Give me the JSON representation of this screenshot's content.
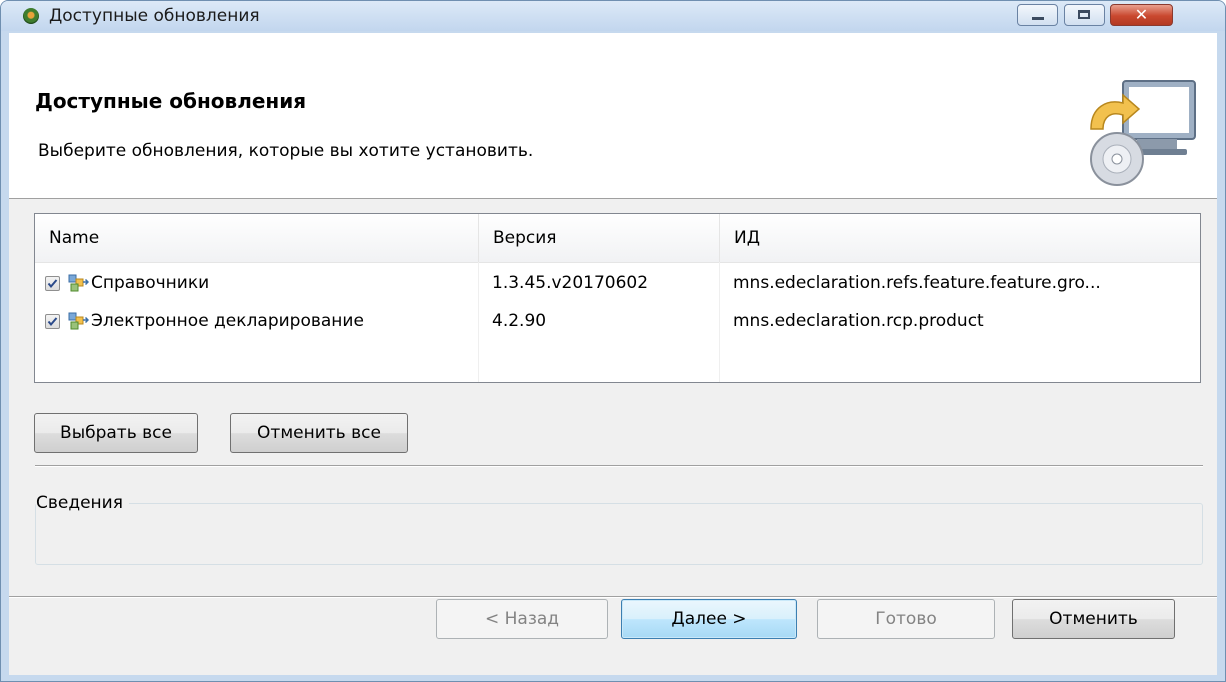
{
  "window": {
    "title": "Доступные обновления",
    "buttons": {
      "close": "✕"
    }
  },
  "banner": {
    "heading": "Доступные обновления",
    "description": "Выберите обновления, которые вы хотите установить."
  },
  "table": {
    "columns": [
      "Name",
      "Версия",
      "ИД"
    ],
    "rows": [
      {
        "checked": true,
        "name": "Справочники",
        "version": "1.3.45.v20170602",
        "id": "mns.edeclaration.refs.feature.feature.gro..."
      },
      {
        "checked": true,
        "name": "Электронное декларирование",
        "version": "4.2.90",
        "id": "mns.edeclaration.rcp.product"
      }
    ]
  },
  "selection_buttons": {
    "select_all": "Выбрать все",
    "deselect_all": "Отменить все"
  },
  "details": {
    "label": "Сведения"
  },
  "nav_buttons": {
    "back": "< Назад",
    "next": "Далее >",
    "finish": "Готово",
    "cancel": "Отменить"
  },
  "colors": {
    "accent_default_button": "#3c7fb1",
    "close_button": "#c9482f",
    "title_bar": "#c6d9ee"
  },
  "icons": [
    "app-icon",
    "update-computer-icon",
    "feature-icon",
    "checkbox-checked-icon"
  ]
}
